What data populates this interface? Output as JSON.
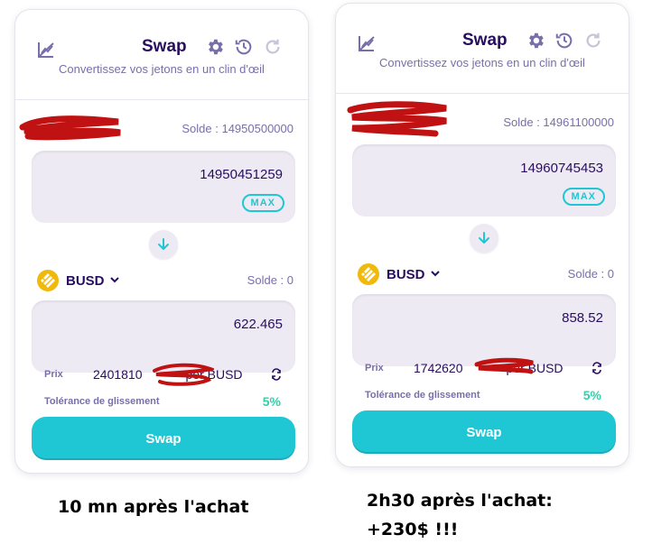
{
  "colors": {
    "title": "#280d5f",
    "secondary": "#7a6eaa",
    "accent": "#1fc7d4",
    "success": "#31d0aa",
    "input_bg": "#eeeaf4",
    "redaction": "#c01212",
    "busd": "#f0b90b"
  },
  "panels": [
    {
      "header": {
        "title": "Swap",
        "subtitle": "Convertissez vos jetons en un clin d'œil"
      },
      "from": {
        "balance": "Solde : 14950500000",
        "amount": "14950451259",
        "max_label": "MAX"
      },
      "to": {
        "token": "BUSD",
        "balance": "Solde : 0",
        "amount": "622.465"
      },
      "price": {
        "label": "Prix",
        "value_visible_start": "2401810",
        "value_visible_end": "per BUSD"
      },
      "slippage": {
        "label": "Tolérance de glissement",
        "value": "5%"
      },
      "swap_label": "Swap",
      "caption_lines": [
        "10 mn après l'achat"
      ]
    },
    {
      "header": {
        "title": "Swap",
        "subtitle": "Convertissez vos jetons en un clin d'œil"
      },
      "from": {
        "balance": "Solde : 14961100000",
        "amount": "14960745453",
        "max_label": "MAX"
      },
      "to": {
        "token": "BUSD",
        "balance": "Solde : 0",
        "amount": "858.52"
      },
      "price": {
        "label": "Prix",
        "value_visible_start": "1742620",
        "value_visible_end": "per BUSD"
      },
      "slippage": {
        "label": "Tolérance de glissement",
        "value": "5%"
      },
      "swap_label": "Swap",
      "caption_lines": [
        "2h30 après l'achat:",
        "+230$ !!!"
      ]
    }
  ],
  "icons": [
    "chart-disabled-icon",
    "gear-icon",
    "history-icon",
    "refresh-icon",
    "arrow-down-icon",
    "busd-token-icon",
    "chevron-down-icon",
    "swap-vertical-icon"
  ]
}
